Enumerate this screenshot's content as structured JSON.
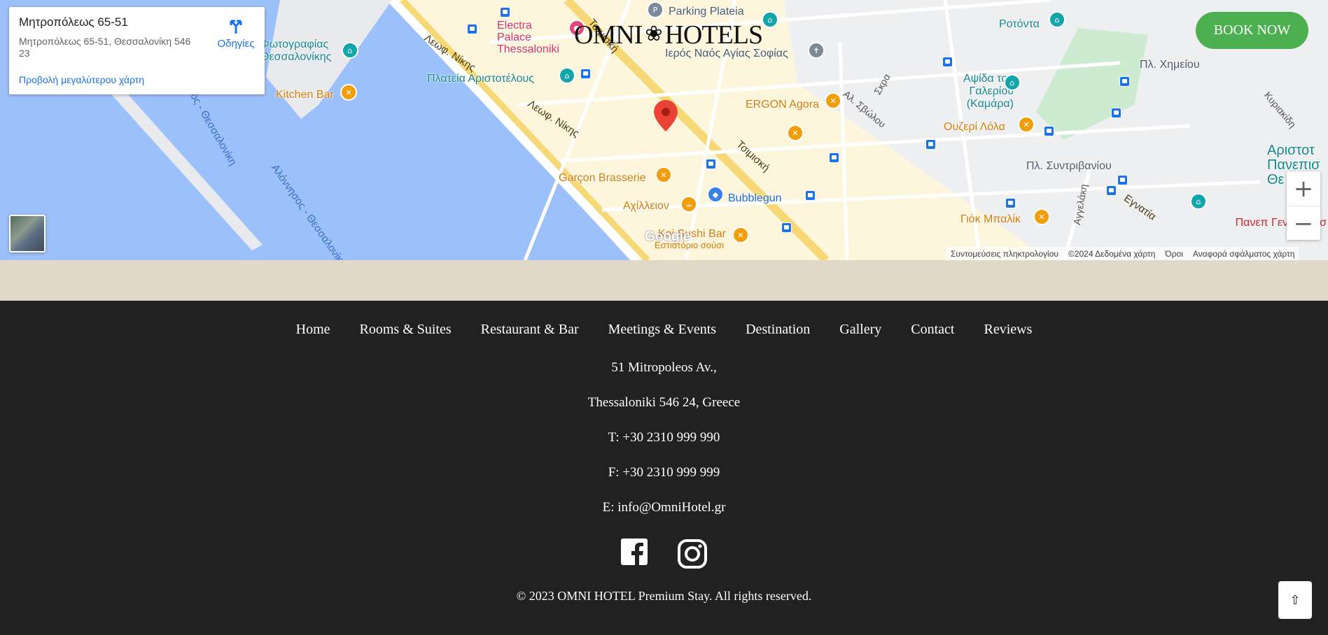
{
  "map": {
    "info_card": {
      "title": "Μητροπόλεως 65-51",
      "address": "Μητροπόλεως 65-51, Θεσσαλονίκη 546 23",
      "directions_label": "Οδηγίες",
      "larger_map_link": "Προβολή μεγαλύτερου χάρτη"
    },
    "labels": {
      "parking": "Parking Plateia",
      "electra": "Electra Palace Thessaloniki",
      "photo_museum": "Φωτογραφίας Θεσσαλονίκης",
      "kitchen_bar": "Kitchen Bar",
      "plateia_aristotelous": "Πλατεία Αριστοτέλους",
      "agia_sofia": "Ιερός Ναός Αγίας Σοφίας",
      "ergon": "ERGON Agora",
      "rotonta": "Ροτόντα",
      "pl_chimeiou": "Πλ. Χημείου",
      "kamara": "Αψίδα του Γαλερίου (Καμάρα)",
      "ouzeri": "Ουζερί Λόλα",
      "pl_syntrivaniou": "Πλ. Συντριβανίου",
      "garcon": "Garçon Brasserie",
      "achilleion": "Αχίλλειον",
      "bubblegun": "Bubblegun",
      "koi": "Koi Sushi Bar",
      "koi_sub": "Εστιατόριο σούσι",
      "giok": "Γιόκ Μπαλίκ",
      "aristotle_uni": "Αριστοτ Πανεπισ Θε",
      "panep_nosok": "Πανεπ Γενικό Νοσ",
      "leof_nikis_1": "Λεωφ. Νίκης",
      "leof_nikis_2": "Λεωφ. Νίκης",
      "tsimiski_1": "Τσιμισκή",
      "tsimiski_2": "Τσιμισκή",
      "egnatia": "Εγνατία",
      "al_svolou": "Αλ. Σβώλου",
      "angelaki": "Αγγελάκη",
      "skra": "Σκρα",
      "kyriakidi": "Κυριακίδη",
      "water_1": "ός - Θεσσαλονίκη",
      "water_2": "Αλόννησος - Θεσσαλονίκη"
    },
    "brand": {
      "left": "OMNI",
      "right": "HOTELS"
    },
    "book_now": "BOOK NOW",
    "google": "Google",
    "attribution": [
      "Συντομεύσεις πληκτρολογίου",
      "©2024 Δεδομένα χάρτη",
      "Όροι",
      "Αναφορά σφάλματος χάρτη"
    ]
  },
  "footer": {
    "nav": [
      "Home",
      "Rooms & Suites",
      "Restaurant & Bar",
      "Meetings & Events",
      "Destination",
      "Gallery",
      "Contact",
      "Reviews"
    ],
    "address_line1": "51 Mitropoleos Av.,",
    "address_line2": "Thessaloniki 546 24, Greece",
    "phone": "T: +30 2310 999 990",
    "fax": "F: +30 2310 999 999",
    "email": "E: info@OmniHotel.gr",
    "copyright": "© 2023 OMNI HOTEL Premium Stay. All rights reserved."
  },
  "colors": {
    "book_now": "#4caf50",
    "footer_bg": "#212121",
    "band": "#e1d9c7",
    "water": "#9cc0f9"
  }
}
